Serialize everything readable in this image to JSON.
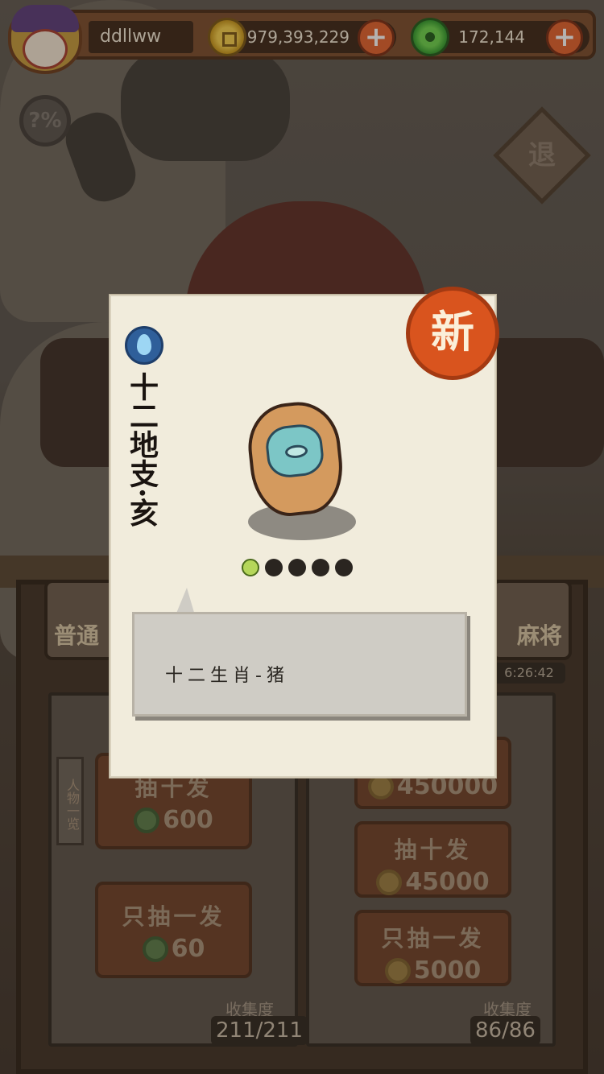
{
  "header": {
    "username": "ddllww",
    "gold_amount": "979,393,229",
    "jade_amount": "172,144",
    "add_label": "+"
  },
  "help_label": "?%",
  "exit_label": "退",
  "modes": {
    "normal_label": "普通",
    "mahjong_label": "麻将",
    "timer": "6:26:42"
  },
  "pool_left": {
    "side_label": "人物一览",
    "draw_ten_label": "抽十发",
    "draw_ten_cost": "600",
    "draw_one_label": "只抽一发",
    "draw_one_cost": "60",
    "progress_label": "收集度",
    "progress_value": "211/211"
  },
  "pool_right": {
    "top_cost": "450000",
    "draw_ten_label": "抽十发",
    "draw_ten_cost": "45000",
    "draw_one_label": "只抽一发",
    "draw_one_cost": "5000",
    "progress_label": "收集度",
    "progress_value": "86/86"
  },
  "card": {
    "new_badge": "新",
    "title": "十二地支·亥",
    "element_icon": "water-drop-icon",
    "stars_total": 5,
    "stars_on": 1,
    "description": "十二生肖-猪"
  },
  "colors": {
    "gold_coin": "#f8d04a",
    "jade_coin": "#4fc43a",
    "new_badge": "#d9541e",
    "card_bg": "#f1ecdc",
    "add_button": "#e4602a"
  }
}
